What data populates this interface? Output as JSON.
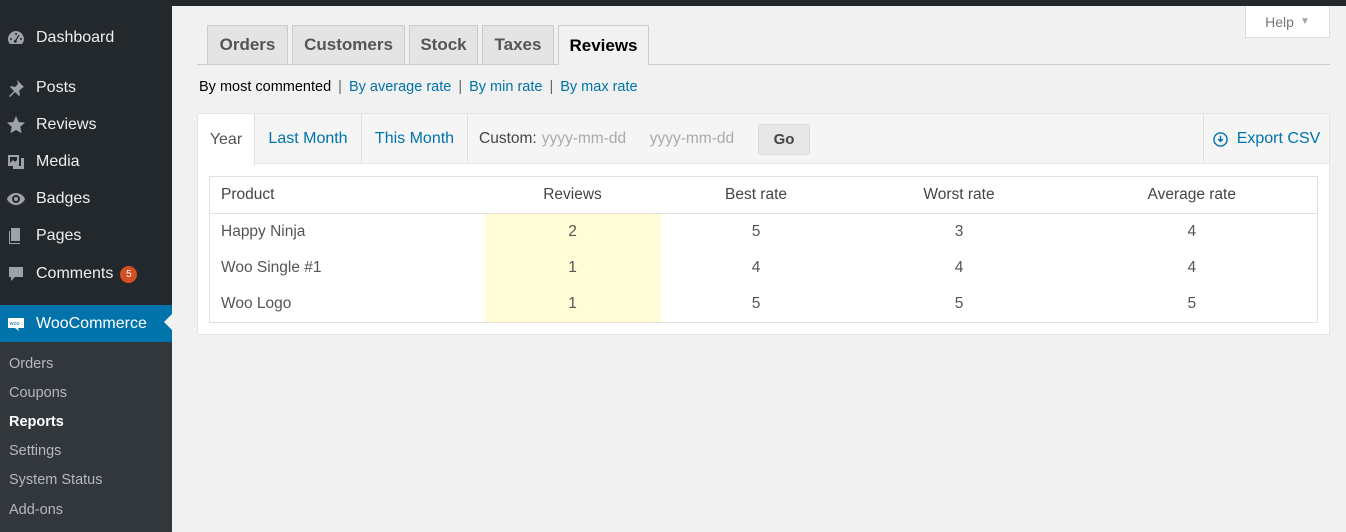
{
  "sidebar": {
    "items": [
      {
        "label": "Dashboard",
        "icon": "dashboard-icon"
      },
      {
        "label": "Posts",
        "icon": "pin-icon"
      },
      {
        "label": "Reviews",
        "icon": "star-icon"
      },
      {
        "label": "Media",
        "icon": "media-icon"
      },
      {
        "label": "Badges",
        "icon": "eye-icon"
      },
      {
        "label": "Pages",
        "icon": "pages-icon"
      },
      {
        "label": "Comments",
        "icon": "comment-icon",
        "badge": "5"
      },
      {
        "label": "WooCommerce",
        "icon": "woo-icon"
      }
    ],
    "submenu": [
      "Orders",
      "Coupons",
      "Reports",
      "Settings",
      "System Status",
      "Add-ons"
    ]
  },
  "help": {
    "label": "Help"
  },
  "tabs": [
    "Orders",
    "Customers",
    "Stock",
    "Taxes",
    "Reviews"
  ],
  "filters": {
    "current": "By most commented",
    "links": [
      "By average rate",
      "By min rate",
      "By max rate"
    ]
  },
  "range": {
    "tabs": [
      "Year",
      "Last Month",
      "This Month"
    ],
    "custom_label": "Custom:",
    "date_placeholder": "yyyy-mm-dd",
    "go_label": "Go",
    "export_label": "Export CSV"
  },
  "table": {
    "headers": [
      "Product",
      "Reviews",
      "Best rate",
      "Worst rate",
      "Average rate"
    ],
    "rows": [
      [
        "Happy Ninja",
        "2",
        "5",
        "3",
        "4"
      ],
      [
        "Woo Single #1",
        "1",
        "4",
        "4",
        "4"
      ],
      [
        "Woo Logo",
        "1",
        "5",
        "5",
        "5"
      ]
    ]
  },
  "colors": {
    "accent": "#0073aa",
    "sidebar": "#23282d",
    "badge": "#d54e21",
    "highlight": "#fffcd6"
  }
}
